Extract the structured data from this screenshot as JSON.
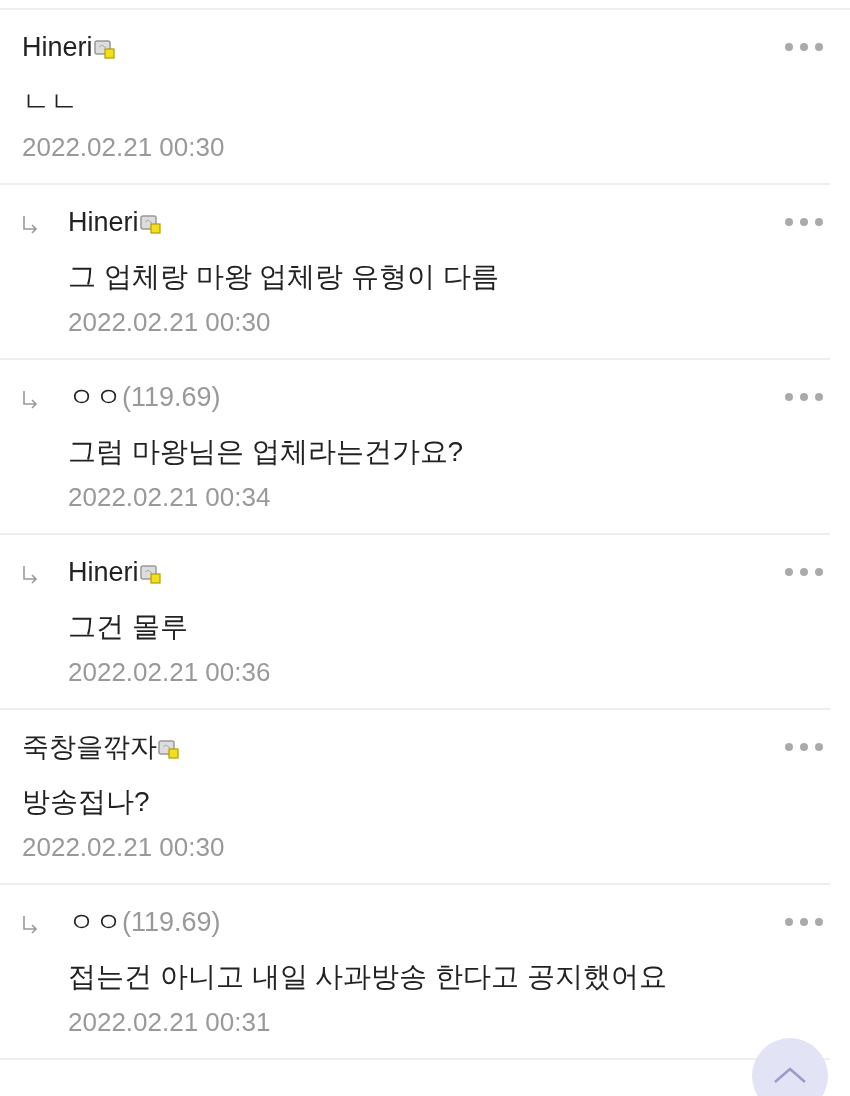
{
  "comments": [
    {
      "kind": "comment",
      "author": "Hineri",
      "member": true,
      "text": "ㄴㄴ",
      "date": "2022.02.21 00:30"
    },
    {
      "kind": "reply",
      "author": "Hineri",
      "member": true,
      "text": "그 업체랑 마왕 업체랑 유형이 다름",
      "date": "2022.02.21 00:30"
    },
    {
      "kind": "reply",
      "author": "ㅇㅇ",
      "member": false,
      "ip": "(119.69)",
      "text": "그럼 마왕님은 업체라는건가요?",
      "date": "2022.02.21 00:34"
    },
    {
      "kind": "reply",
      "author": "Hineri",
      "member": true,
      "text": "그건 몰루",
      "date": "2022.02.21 00:36"
    },
    {
      "kind": "comment",
      "author": "죽창을깎자",
      "member": true,
      "text": "방송접나?",
      "date": "2022.02.21 00:30"
    },
    {
      "kind": "reply",
      "author": "ㅇㅇ",
      "member": false,
      "ip": "(119.69)",
      "text": "접는건 아니고 내일 사과방송 한다고 공지했어요",
      "date": "2022.02.21 00:31"
    }
  ]
}
